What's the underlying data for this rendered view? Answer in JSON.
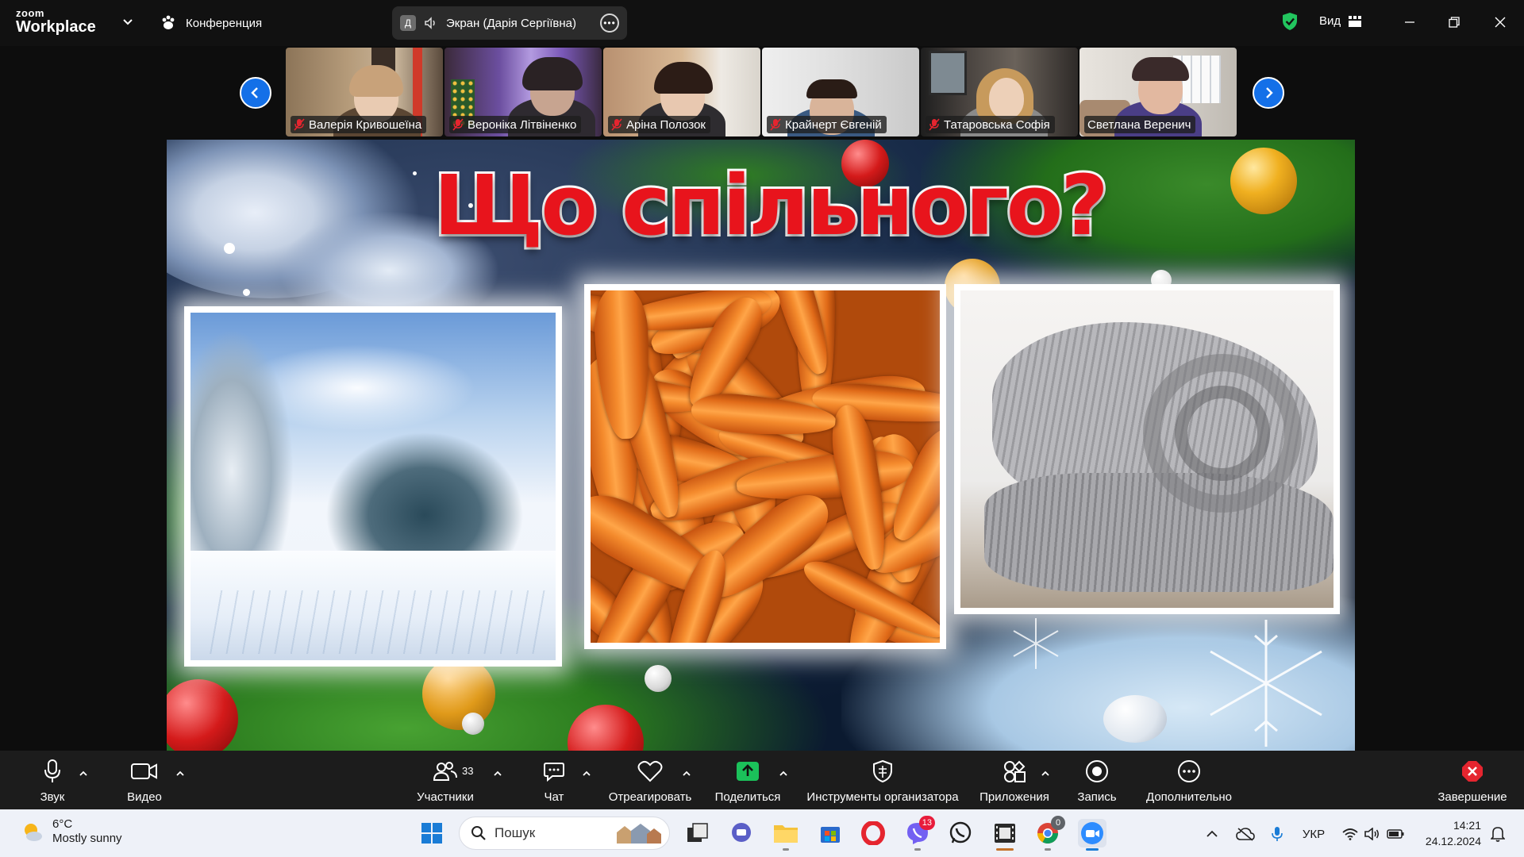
{
  "app": {
    "logo_line1": "zoom",
    "logo_line2": "Workplace",
    "conference_label": "Конференция",
    "share_avatar": "Д",
    "share_label": "Экран (Дарія Сергіївна)",
    "view_label": "Вид"
  },
  "participants": [
    {
      "name": "Валерія Кривошеїна",
      "muted": true
    },
    {
      "name": "Вероніка Літвіненко",
      "muted": true
    },
    {
      "name": "Аріна Полозок",
      "muted": true
    },
    {
      "name": "Крайнерт Євгеній",
      "muted": true
    },
    {
      "name": "Татаровська Софія",
      "muted": true
    },
    {
      "name": "Светлана Веренич",
      "muted": false
    }
  ],
  "slide": {
    "title": "Що спільного?",
    "images": [
      "snowy-forest",
      "carrots",
      "knitted-scarf"
    ]
  },
  "toolbar": {
    "audio": "Звук",
    "video": "Видео",
    "participants": "Участники",
    "participants_count": "33",
    "chat": "Чат",
    "react": "Отреагировать",
    "share": "Поделиться",
    "host_tools": "Инструменты организатора",
    "apps": "Приложения",
    "record": "Запись",
    "more": "Дополнительно",
    "end": "Завершение"
  },
  "taskbar": {
    "temperature": "6°C",
    "weather": "Mostly sunny",
    "search_placeholder": "Пошук",
    "viber_badge": "13",
    "chrome_badge": "0",
    "language": "УКР",
    "time": "14:21",
    "date": "24.12.2024"
  },
  "colors": {
    "accent_blue": "#1470e8",
    "share_green": "#1bc15a",
    "end_red": "#e5252f",
    "title_red": "#e8141c"
  }
}
